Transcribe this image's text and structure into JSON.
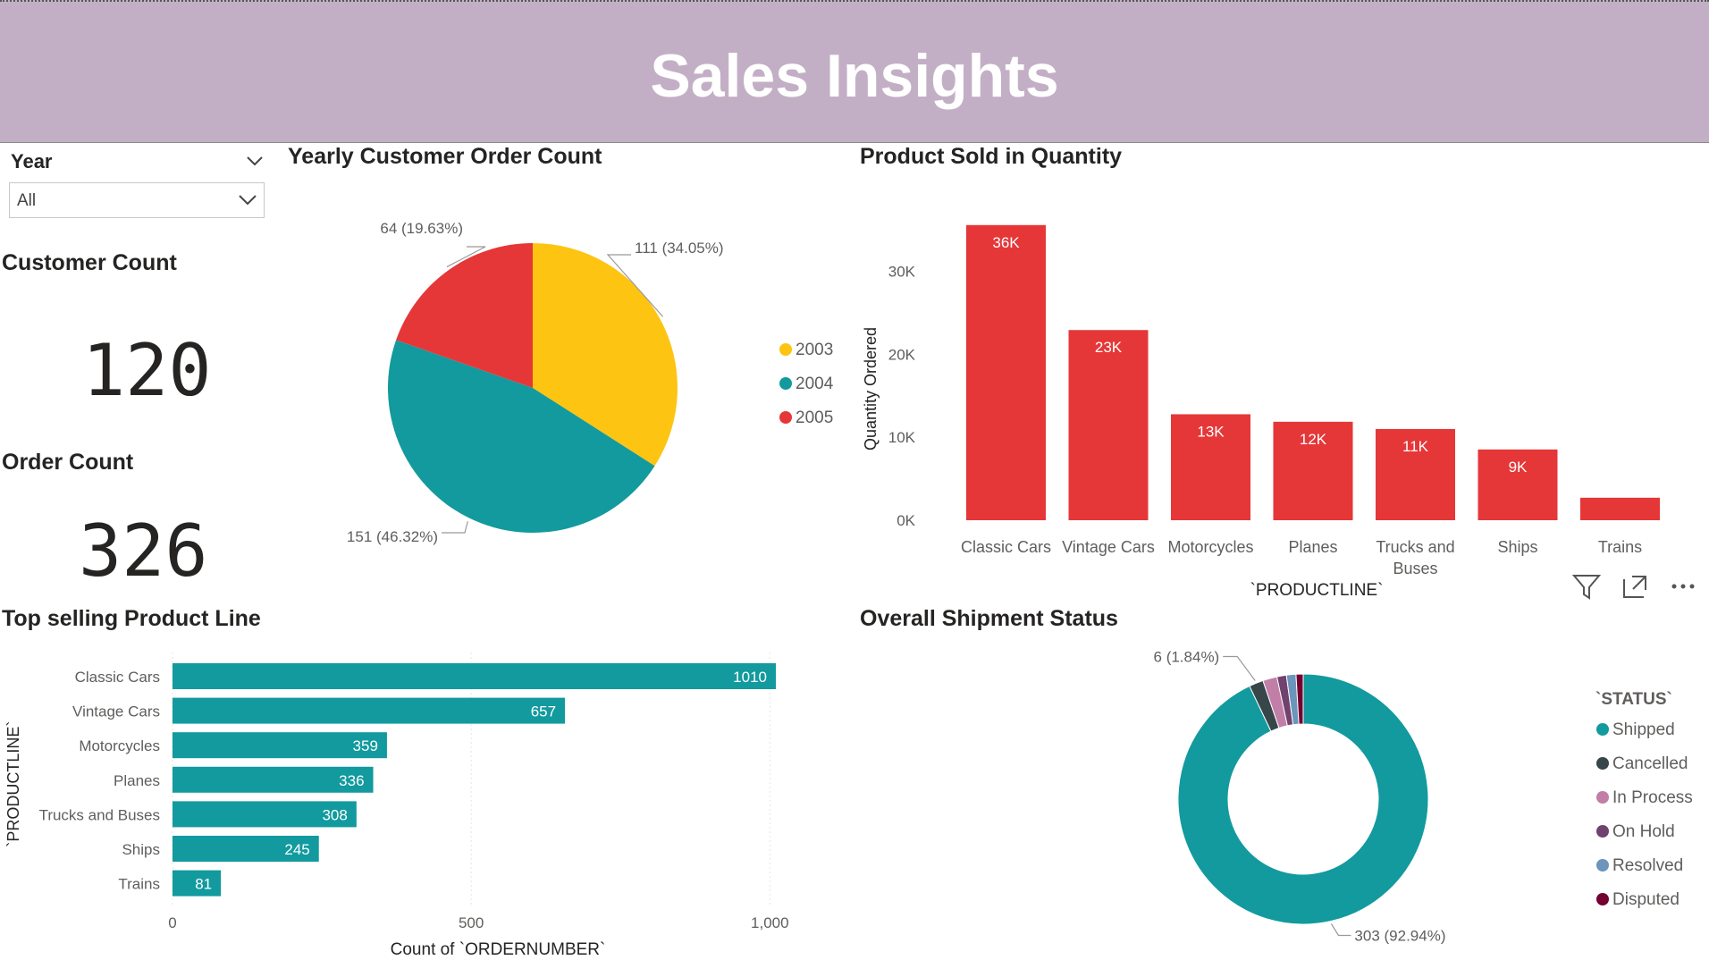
{
  "header": {
    "title": "Sales Insights"
  },
  "slicer": {
    "title": "Year",
    "value": "All"
  },
  "cards": [
    {
      "title": "Customer Count",
      "value": "120"
    },
    {
      "title": "Order Count",
      "value": "326"
    }
  ],
  "colors": {
    "header_bg": "#c3afc5",
    "teal": "#129a9e",
    "red": "#e53738",
    "yellow": "#fdc412"
  },
  "icons": {
    "filter": "filter-icon",
    "focus": "focus-mode-icon",
    "more": "more-options-icon"
  },
  "chart_data": [
    {
      "id": "pie",
      "type": "pie",
      "title": "Yearly Customer Order Count",
      "slices": [
        {
          "label": "2003",
          "value": 111,
          "display": "111 (34.05%)",
          "color": "#fdc412"
        },
        {
          "label": "2004",
          "value": 151,
          "display": "151 (46.32%)",
          "color": "#129a9e"
        },
        {
          "label": "2005",
          "value": 64,
          "display": "64 (19.63%)",
          "color": "#e53738"
        }
      ],
      "legend": "right"
    },
    {
      "id": "bar",
      "type": "bar",
      "title": "Product Sold in Quantity",
      "categories": [
        "Classic Cars",
        "Vintage Cars",
        "Motorcycles",
        "Planes",
        "Trucks and Buses",
        "Ships",
        "Trains"
      ],
      "values": [
        35592,
        22933,
        12778,
        11872,
        11001,
        8532,
        2712
      ],
      "data_labels": [
        "36K",
        "23K",
        "13K",
        "12K",
        "11K",
        "9K",
        ""
      ],
      "xlabel": "`PRODUCTLINE`",
      "ylabel": "Quantity Ordered",
      "yticks": [
        0,
        10000,
        20000,
        30000
      ],
      "ytick_labels": [
        "0K",
        "10K",
        "20K",
        "30K"
      ],
      "ylim": [
        0,
        36000
      ],
      "grid": false,
      "color": "#e53738"
    },
    {
      "id": "hbar",
      "type": "bar",
      "orientation": "horizontal",
      "title": "Top selling Product Line",
      "categories": [
        "Classic Cars",
        "Vintage Cars",
        "Motorcycles",
        "Planes",
        "Trucks and Buses",
        "Ships",
        "Trains"
      ],
      "values": [
        1010,
        657,
        359,
        336,
        308,
        245,
        81
      ],
      "xlabel": "Count of `ORDERNUMBER`",
      "ylabel": "`PRODUCTLINE`",
      "xticks": [
        0,
        500,
        1000
      ],
      "xtick_labels": [
        "0",
        "500",
        "1,000"
      ],
      "xlim": [
        0,
        1010
      ],
      "grid": true,
      "color": "#129a9e"
    },
    {
      "id": "donut",
      "type": "pie",
      "variant": "donut",
      "title": "Overall Shipment Status",
      "legend_title": "`STATUS`",
      "legend": "right",
      "slices": [
        {
          "label": "Shipped",
          "value": 303,
          "display": "303 (92.94%)",
          "color": "#129a9e"
        },
        {
          "label": "Cancelled",
          "value": 6,
          "display": "6 (1.84%)",
          "color": "#374649"
        },
        {
          "label": "In Process",
          "value": 6,
          "display": "",
          "color": "#c17ea7"
        },
        {
          "label": "On Hold",
          "value": 4,
          "display": "",
          "color": "#71416f"
        },
        {
          "label": "Resolved",
          "value": 4,
          "display": "",
          "color": "#6b95bb"
        },
        {
          "label": "Disputed",
          "value": 3,
          "display": "",
          "color": "#740031"
        }
      ]
    }
  ]
}
